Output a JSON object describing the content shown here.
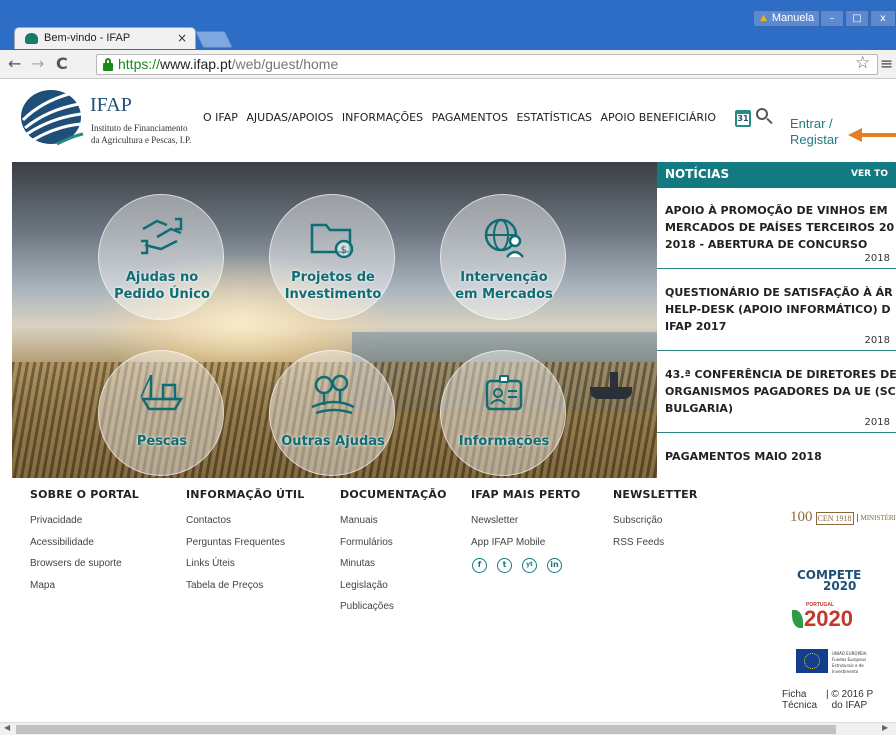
{
  "browser": {
    "tab_title": "Bem-vindo - IFAP",
    "tab_close": "×",
    "user": "Manuela",
    "url_scheme": "https://",
    "url_domain": "www.ifap.pt",
    "url_path": "/web/guest/home",
    "window_buttons": [
      "–",
      "□",
      "x"
    ]
  },
  "header": {
    "logo_name": "IFAP",
    "logo_sub1": "Instituto de Financiamento",
    "logo_sub2": "da Agricultura e Pescas, I.P.",
    "nav": [
      "O IFAP",
      "AJUDAS/APOIOS",
      "INFORMAÇÕES",
      "PAGAMENTOS",
      "ESTATÍSTICAS",
      "APOIO BENEFICIÁRIO"
    ],
    "calendar_day": "31",
    "login_line1": "Entrar /",
    "login_line2": "Registar"
  },
  "hero": {
    "circles": [
      {
        "label1": "Ajudas no",
        "label2": "Pedido Único",
        "icon": "handshake-icon"
      },
      {
        "label1": "Projetos de",
        "label2": "Investimento",
        "icon": "folder-money-icon"
      },
      {
        "label1": "Intervenção",
        "label2": "em Mercados",
        "icon": "globe-person-icon"
      },
      {
        "label1": "",
        "label2": "Pescas",
        "icon": "fishing-boat-icon"
      },
      {
        "label1": "",
        "label2": "Outras Ajudas",
        "icon": "trees-icon"
      },
      {
        "label1": "",
        "label2": "Informações",
        "icon": "id-card-icon"
      }
    ]
  },
  "news": {
    "title": "NOTÍCIAS",
    "view_all": "VER TO",
    "items": [
      {
        "l1": "APOIO À PROMOÇÃO DE VINHOS EM",
        "l2": "MERCADOS DE PAÍSES TERCEIROS 20",
        "l3": "2018 - ABERTURA DE CONCURSO",
        "date": "2018"
      },
      {
        "l1": "QUESTIONÁRIO DE SATISFAÇÃO À ÁR",
        "l2": "HELP-DESK (APOIO INFORMÁTICO) D",
        "l3": "IFAP 2017",
        "date": "2018"
      },
      {
        "l1": "43.ª CONFERÊNCIA DE DIRETORES DE",
        "l2": "ORGANISMOS PAGADORES DA UE (SC",
        "l3": "BULGARIA)",
        "date": "2018"
      },
      {
        "l1": "PAGAMENTOS MAIO 2018",
        "l2": "",
        "l3": "",
        "date": ""
      }
    ]
  },
  "footer": {
    "cols": [
      {
        "heading": "SOBRE O PORTAL",
        "links": [
          "Privacidade",
          "Acessibilidade",
          "Browsers de suporte",
          "Mapa"
        ]
      },
      {
        "heading": "INFORMAÇÃO ÚTIL",
        "links": [
          "Contactos",
          "Perguntas Frequentes",
          "Links Úteis",
          "Tabela de Preços"
        ]
      },
      {
        "heading": "DOCUMENTAÇÃO",
        "links": [
          "Manuais",
          "Formulários",
          "Minutas",
          "Legislação",
          "Publicações"
        ]
      },
      {
        "heading": "IFAP MAIS PERTO",
        "links": [
          "Newsletter",
          "App IFAP Mobile"
        ]
      },
      {
        "heading": "NEWSLETTER",
        "links": [
          "Subscrição",
          "RSS Feeds"
        ]
      }
    ],
    "social": [
      "f",
      "t",
      "yt",
      "in"
    ],
    "logo_100": "100",
    "logo_100_mark": "CEN 1918",
    "logo_ministry": "MINISTÉRIO DA AGRICULTURA",
    "logo_compete": "COMPETE",
    "logo_compete_year": "2020",
    "logo_portugal": "PORTUGAL",
    "logo_2020": "2020",
    "logo_eu_text": "UNIÃO EUROPEIA Fundos Europeus Estruturais e de Investimento",
    "ficha_l1": "Ficha",
    "ficha_l2": "Técnica",
    "copy_l1": "© 2016 P",
    "copy_l2": "do IFAP"
  }
}
